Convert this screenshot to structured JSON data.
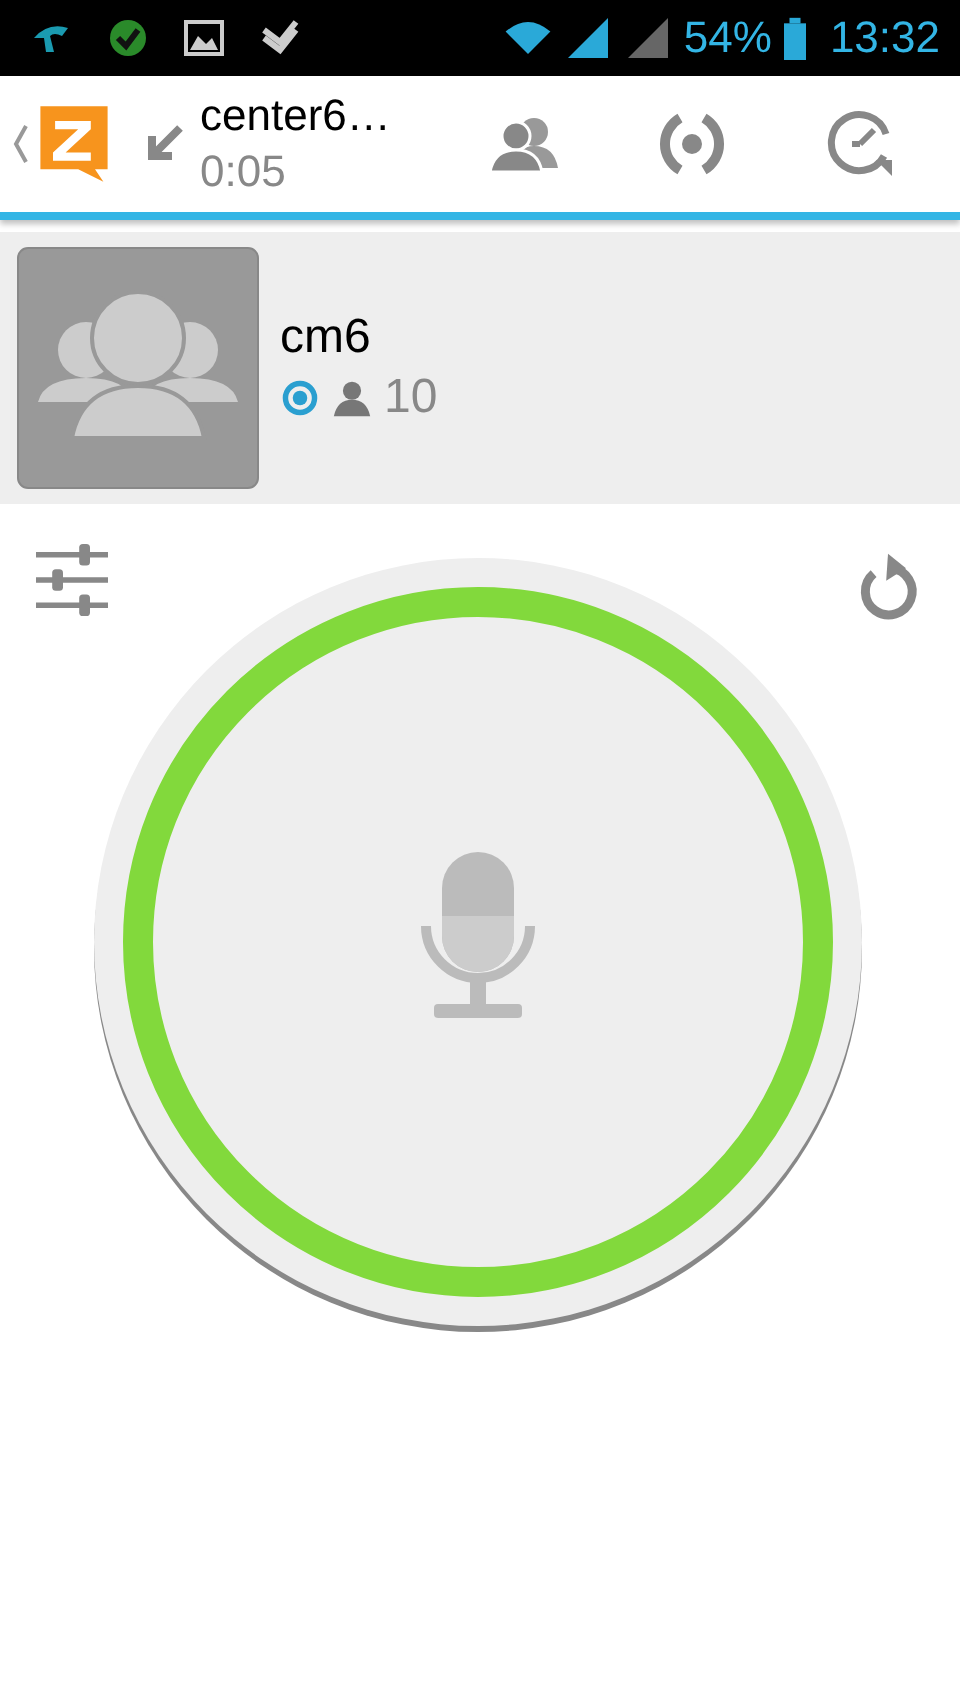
{
  "status_bar": {
    "battery": "54%",
    "time": "13:32"
  },
  "header": {
    "title": "center6…",
    "duration": "0:05"
  },
  "channel": {
    "name": "cm6",
    "users": "10"
  }
}
